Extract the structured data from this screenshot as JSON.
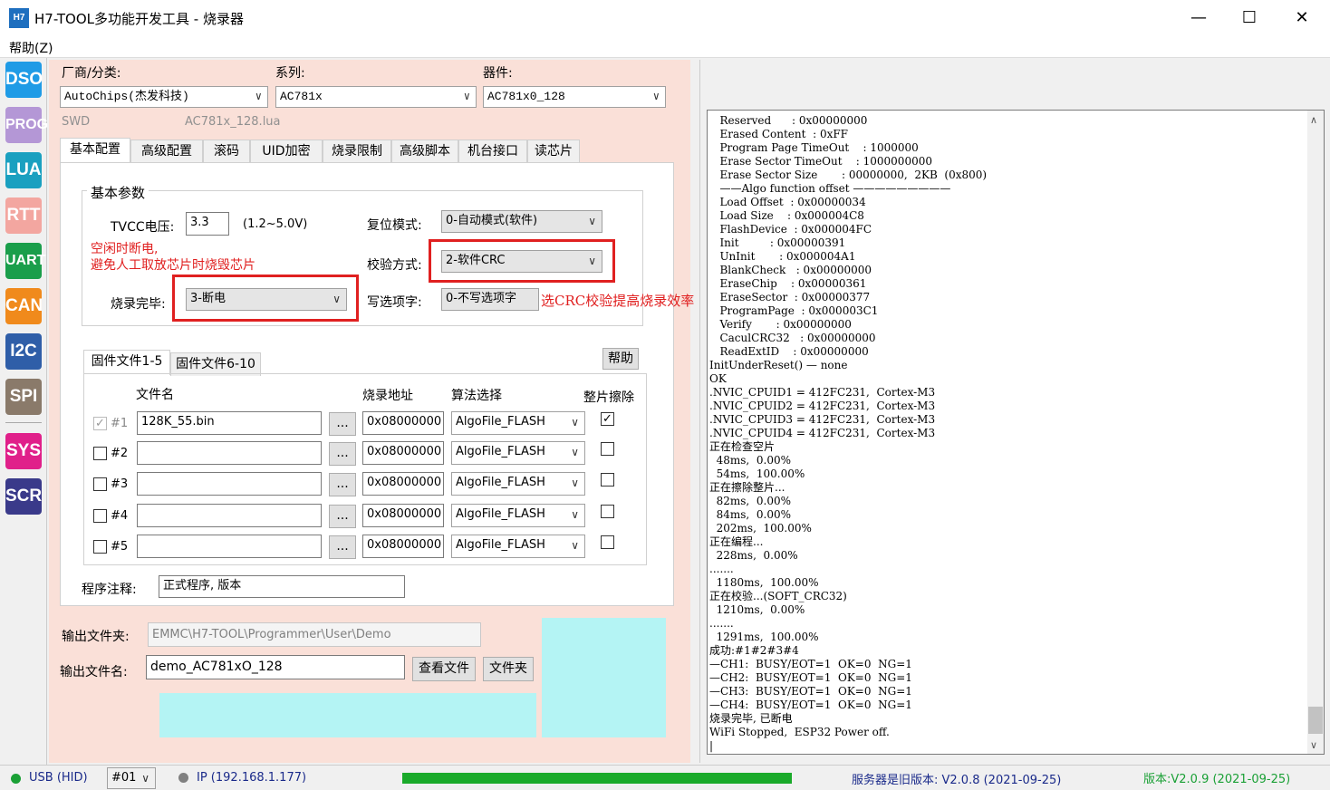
{
  "window": {
    "icon_text": "H7",
    "title": "H7-TOOL多功能开发工具 - 烧录器",
    "min": "—",
    "max": "☐",
    "close": "✕"
  },
  "menu": {
    "help": "帮助(Z)"
  },
  "sidebar": [
    {
      "label": "DSO",
      "color": "#1f9be6"
    },
    {
      "label": "PROG",
      "color": "#b497d6"
    },
    {
      "label": "LUA",
      "color": "#1aa0c0"
    },
    {
      "label": "RTT",
      "color": "#f3a6a0"
    },
    {
      "label": "UART",
      "color": "#1a9e4b"
    },
    {
      "label": "CAN",
      "color": "#f08a1c"
    },
    {
      "label": "I2C",
      "color": "#2f5ea8"
    },
    {
      "label": "SPI",
      "color": "#8a7a6a"
    },
    {
      "label": "SYS",
      "color": "#e0208a"
    },
    {
      "label": "SCR",
      "color": "#3a3a8a"
    }
  ],
  "selectors": {
    "vendor_label": "厂商/分类:",
    "vendor": "AutoChips(杰发科技)",
    "series_label": "系列:",
    "series": "AC781x",
    "device_label": "器件:",
    "device": "AC781x0_128",
    "iface": "SWD",
    "lua_file": "AC781x_128.lua"
  },
  "tabs": [
    "基本配置",
    "高级配置",
    "滚码",
    "UID加密",
    "烧录限制",
    "高级脚本",
    "机台接口",
    "读芯片"
  ],
  "basic": {
    "group_title": "基本参数",
    "tvcc_label": "TVCC电压:",
    "tvcc_value": "3.3",
    "tvcc_range": "(1.2~5.0V)",
    "reset_label": "复位模式:",
    "reset_value": "0-自动模式(软件)",
    "verify_label": "校验方式:",
    "verify_value": "2-软件CRC",
    "done_label": "烧录完毕:",
    "done_value": "3-断电",
    "option_label": "写选项字:",
    "option_value": "0-不写选项字",
    "note1_line1": "空闲时断电,",
    "note1_line2": "避免人工取放芯片时烧毁芯片",
    "note2": "选CRC校验提高烧录效率"
  },
  "firmware": {
    "tab1": "固件文件1-5",
    "tab2": "固件文件6-10",
    "help": "帮助",
    "col_file": "文件名",
    "col_addr": "烧录地址",
    "col_algo": "算法选择",
    "col_erase": "整片擦除",
    "browse": "...",
    "rows": [
      {
        "id": "#1",
        "file": "128K_55.bin",
        "addr": "0x08000000",
        "algo": "AlgoFile_FLASH",
        "checked": "✓",
        "erase": "✓"
      },
      {
        "id": "#2",
        "file": "",
        "addr": "0x08000000",
        "algo": "AlgoFile_FLASH",
        "checked": "",
        "erase": ""
      },
      {
        "id": "#3",
        "file": "",
        "addr": "0x08000000",
        "algo": "AlgoFile_FLASH",
        "checked": "",
        "erase": ""
      },
      {
        "id": "#4",
        "file": "",
        "addr": "0x08000000",
        "algo": "AlgoFile_FLASH",
        "checked": "",
        "erase": ""
      },
      {
        "id": "#5",
        "file": "",
        "addr": "0x08000000",
        "algo": "AlgoFile_FLASH",
        "checked": "",
        "erase": ""
      }
    ],
    "comment_label": "程序注释:",
    "comment_value": "正式程序, 版本"
  },
  "output": {
    "folder_label": "输出文件夹:",
    "folder_value": "EMMC\\H7-TOOL\\Programmer\\User\\Demo",
    "name_label": "输出文件名:",
    "name_value": "demo_AC781xO_128",
    "view_btn": "查看文件",
    "folder_btn": "文件夹"
  },
  "log": "   Reserved      : 0x00000000\n   Erased Content  : 0xFF\n   Program Page TimeOut    : 1000000\n   Erase Sector TimeOut    : 1000000000\n   Erase Sector Size       : 00000000,  2KB  (0x800)\n   ——Algo function offset —————————\n   Load Offset  : 0x00000034\n   Load Size    : 0x000004C8\n   FlashDevice  : 0x000004FC\n   Init         : 0x00000391\n   UnInit       : 0x000004A1\n   BlankCheck   : 0x00000000\n   EraseChip    : 0x00000361\n   EraseSector  : 0x00000377\n   ProgramPage  : 0x000003C1\n   Verify       : 0x00000000\n   CaculCRC32   : 0x00000000\n   ReadExtID    : 0x00000000\nInitUnderReset() — none\nOK\n.NVIC_CPUID1 = 412FC231,  Cortex-M3\n.NVIC_CPUID2 = 412FC231,  Cortex-M3\n.NVIC_CPUID3 = 412FC231,  Cortex-M3\n.NVIC_CPUID4 = 412FC231,  Cortex-M3\n正在检查空片\n  48ms,  0.00%\n  54ms,  100.00%\n正在擦除整片...\n  82ms,  0.00%\n  84ms,  0.00%\n  202ms,  100.00%\n正在编程...\n  228ms,  0.00%\n.......\n  1180ms,  100.00%\n正在校验...(SOFT_CRC32)\n  1210ms,  0.00%\n.......\n  1291ms,  100.00%\n成功:#1#2#3#4\n—CH1:  BUSY/EOT=1  OK=0  NG=1\n—CH2:  BUSY/EOT=1  OK=0  NG=1\n—CH3:  BUSY/EOT=1  OK=0  NG=1\n—CH4:  BUSY/EOT=1  OK=0  NG=1\n烧录完毕, 已断电\nWiFi Stopped,  ESP32 Power off.\n|",
  "status": {
    "usb": "USB (HID)",
    "channel": "#01",
    "ip": "IP (192.168.1.177)",
    "progress": 1.0,
    "server": "服务器是旧版本: V2.0.8 (2021-09-25)",
    "version": "版本:V2.0.9 (2021-09-25)"
  }
}
